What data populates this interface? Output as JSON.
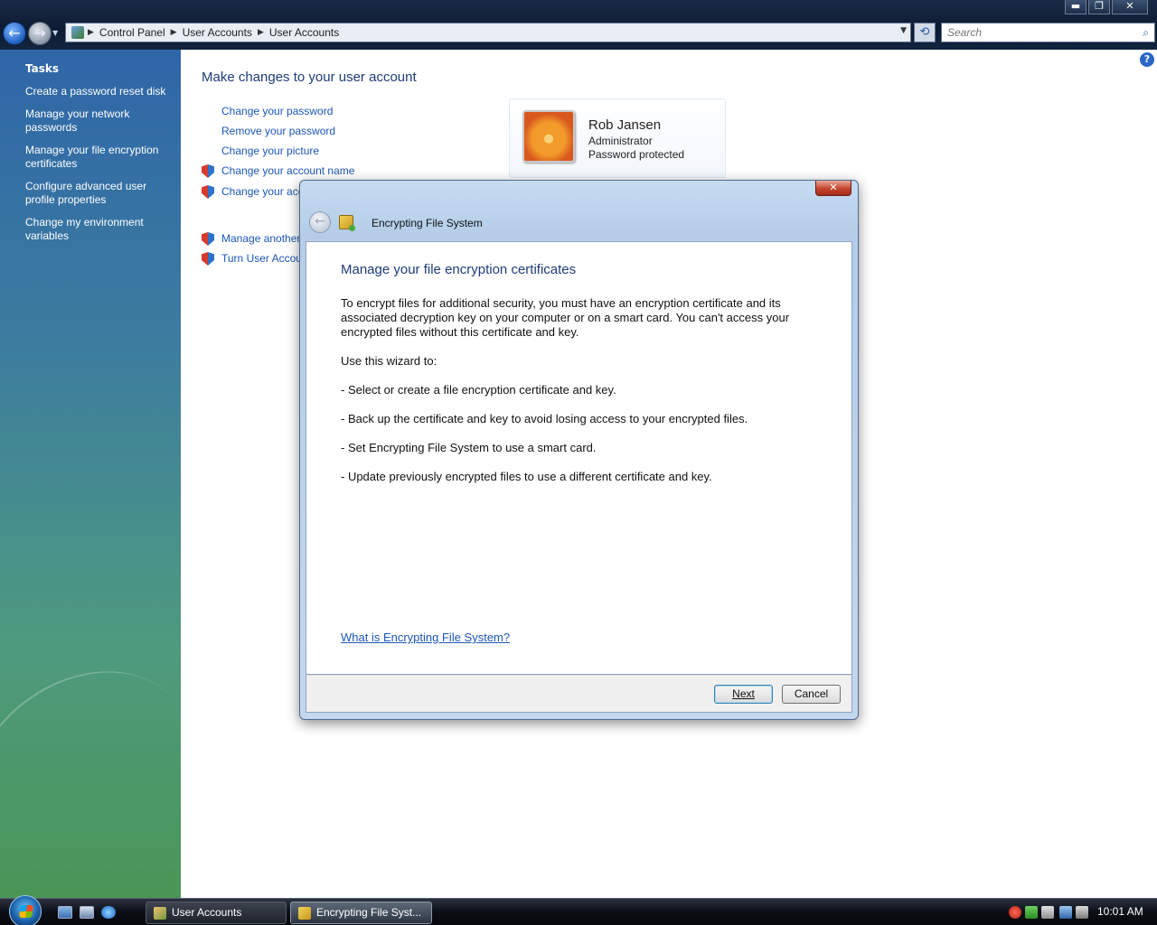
{
  "window": {
    "minimize_label": "▬",
    "restore_label": "❐",
    "close_label": "✕"
  },
  "nav": {
    "back_glyph": "←",
    "forward_glyph": "→"
  },
  "address": {
    "crumbs": [
      "Control Panel",
      "User Accounts",
      "User Accounts"
    ]
  },
  "search": {
    "placeholder": "Search"
  },
  "sidebar": {
    "title": "Tasks",
    "items": [
      "Create a password reset disk",
      "Manage your network passwords",
      "Manage your file encryption certificates",
      "Configure advanced user profile properties",
      "Change my environment variables"
    ]
  },
  "main": {
    "title": "Make changes to your user account",
    "actions": [
      "Change your password",
      "Remove your password",
      "Change your picture",
      "Change your account name",
      "Change your account type",
      "Manage another account",
      "Turn User Account Control on or off"
    ],
    "user": {
      "name": "Rob Jansen",
      "role": "Administrator",
      "password_status": "Password protected"
    }
  },
  "dialog": {
    "close_label": "✕",
    "window_title": "Encrypting File System",
    "heading": "Manage your file encryption certificates",
    "paragraphs": [
      "To encrypt files for additional security, you must have an encryption certificate and its associated decryption key on your computer or on a smart card. You can't access your encrypted files without this certificate and key.",
      "Use this wizard to:",
      "- Select or create a file encryption certificate and key.",
      "- Back up the certificate and key to avoid losing access to your encrypted files.",
      "- Set Encrypting File System to use a smart card.",
      "- Update previously encrypted files to use a different certificate and key."
    ],
    "help_link": "What is Encrypting File System?",
    "next_label": "Next",
    "cancel_label": "Cancel"
  },
  "taskbar": {
    "buttons": [
      "User Accounts",
      "Encrypting File Syst..."
    ],
    "clock": "10:01 AM"
  }
}
